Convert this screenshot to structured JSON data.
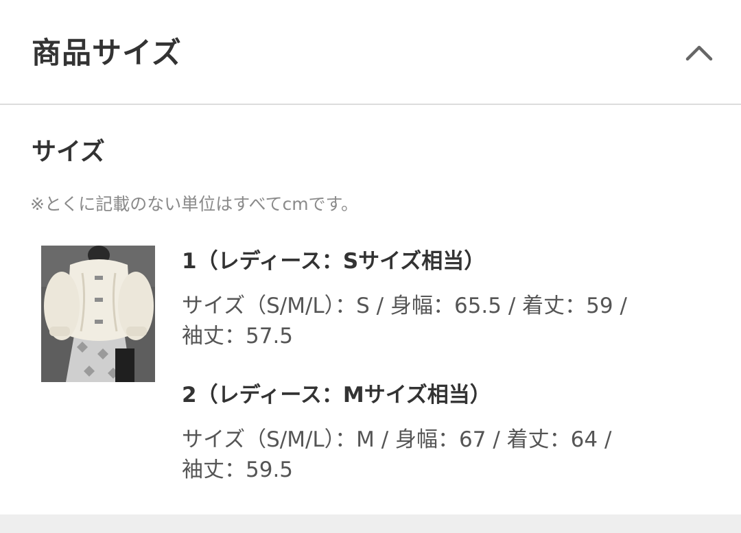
{
  "accordion": {
    "title": "商品サイズ",
    "toggle_icon": "chevron-up-icon",
    "expanded": true
  },
  "size_section": {
    "title": "サイズ",
    "note": "※とくに記載のない単位はすべてcmです。"
  },
  "product_image": {
    "alt": "product-photo"
  },
  "sizes": [
    {
      "label": "1（レディース：Sサイズ相当）",
      "detail": "サイズ（S/M/L）：S / 身幅：65.5 / 着丈：59 /\n袖丈：57.5"
    },
    {
      "label": "2（レディース：Mサイズ相当）",
      "detail": "サイズ（S/M/L）：M / 身幅：67 / 着丈：64 /\n袖丈：59.5"
    }
  ],
  "colors": {
    "text": "#333333",
    "note": "#8a8a8a",
    "divider": "#dcdcdc",
    "footer": "#eeeeee"
  }
}
